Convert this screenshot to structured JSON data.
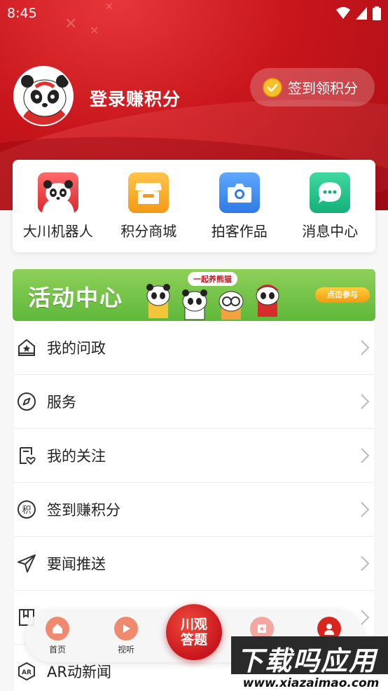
{
  "status_bar": {
    "time": "8:45"
  },
  "profile": {
    "login_text": "登录赚积分",
    "checkin_label": "签到领积分"
  },
  "quick_actions": [
    {
      "label": "大川机器人",
      "icon": "panda-robot-icon",
      "color": "#e8424a"
    },
    {
      "label": "积分商城",
      "icon": "shop-icon",
      "color": "#f5a623"
    },
    {
      "label": "拍客作品",
      "icon": "camera-icon",
      "color": "#3d8ef0"
    },
    {
      "label": "消息中心",
      "icon": "chat-icon",
      "color": "#27c08a"
    }
  ],
  "banner": {
    "title": "活动中心",
    "subtitle": "一起养熊猫",
    "button": "点击参与"
  },
  "menu": [
    {
      "label": "我的问政",
      "icon": "house-star-icon"
    },
    {
      "label": "服务",
      "icon": "compass-icon"
    },
    {
      "label": "我的关注",
      "icon": "bookmark-heart-icon"
    },
    {
      "label": "签到赚积分",
      "icon": "points-icon"
    },
    {
      "label": "要闻推送",
      "icon": "send-icon"
    },
    {
      "label": "",
      "icon": "book-icon"
    },
    {
      "label": "AR动新闻",
      "icon": "ar-icon"
    }
  ],
  "bottom_nav": {
    "items": [
      {
        "label": "首页",
        "icon": "home-icon"
      },
      {
        "label": "视听",
        "icon": "play-icon"
      },
      {
        "label": "",
        "icon": "news-icon"
      },
      {
        "label": "",
        "icon": "user-icon"
      }
    ],
    "center": {
      "line1": "川观",
      "line2": "答题"
    }
  },
  "watermark": {
    "title": "下载吗应用",
    "url": "www.xiazaimao.com"
  },
  "colors": {
    "brand_red": "#c8161c",
    "banner_green": "#5fb83a"
  }
}
